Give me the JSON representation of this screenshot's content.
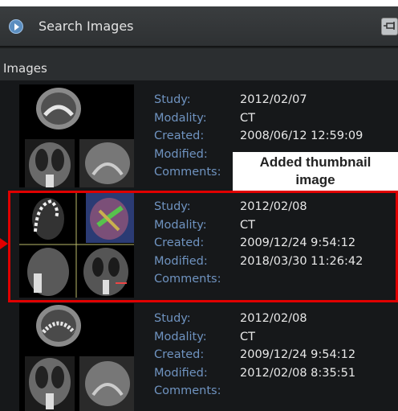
{
  "header": {
    "title": "Search Images"
  },
  "section": {
    "title": "Images"
  },
  "labels": {
    "study": "Study:",
    "modality": "Modality:",
    "created": "Created:",
    "modified": "Modified:",
    "comments": "Comments:"
  },
  "images": [
    {
      "study": "2012/02/07",
      "modality": "CT",
      "created": "2008/06/12 12:59:09",
      "modified": "",
      "comments": ""
    },
    {
      "study": "2012/02/08",
      "modality": "CT",
      "created": "2009/12/24 9:54:12",
      "modified": "2018/03/30 11:26:42",
      "comments": ""
    },
    {
      "study": "2012/02/08",
      "modality": "CT",
      "created": "2009/12/24 9:54:12",
      "modified": "2012/02/08 8:35:51",
      "comments": ""
    }
  ],
  "callout": {
    "line1": "Added thumbnail",
    "line2": "image"
  },
  "colors": {
    "highlight": "#e00000",
    "label": "#6f93c0",
    "value": "#e8e8e8",
    "panel": "#1a1c1d"
  }
}
